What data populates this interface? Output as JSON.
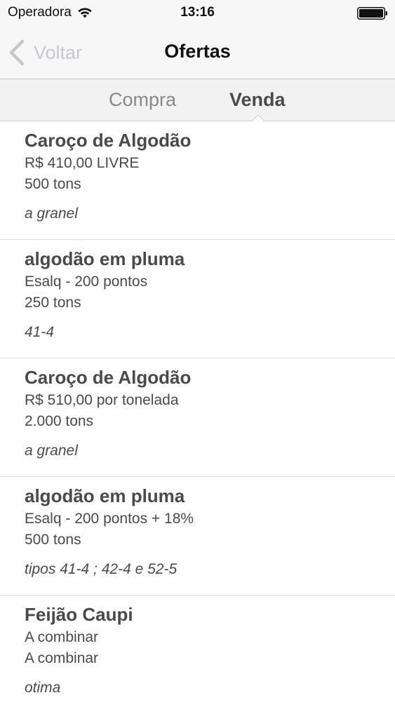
{
  "status_bar": {
    "carrier": "Operadora",
    "time": "13:16",
    "wifi_icon": "wifi-icon",
    "battery_icon": "battery-icon"
  },
  "nav": {
    "back_label": "Voltar",
    "back_icon": "chevron-left-icon",
    "title": "Ofertas"
  },
  "tabs": [
    {
      "label": "Compra",
      "selected": false
    },
    {
      "label": "Venda",
      "selected": true
    }
  ],
  "offers": [
    {
      "title": "Caroço de Algodão",
      "price": "R$ 410,00 LIVRE",
      "quantity": "500 tons",
      "note": "a granel"
    },
    {
      "title": "algodão em pluma",
      "price": "Esalq - 200 pontos",
      "quantity": "250 tons",
      "note": "41-4"
    },
    {
      "title": "Caroço de Algodão",
      "price": "R$ 510,00 por tonelada",
      "quantity": "2.000 tons",
      "note": "a granel"
    },
    {
      "title": "algodão em pluma",
      "price": "Esalq - 200 pontos + 18%",
      "quantity": "500 tons",
      "note": "tipos 41-4 ; 42-4 e 52-5"
    },
    {
      "title": "Feijão Caupi",
      "price": "A combinar",
      "quantity": "A combinar",
      "note": "otima"
    }
  ]
}
